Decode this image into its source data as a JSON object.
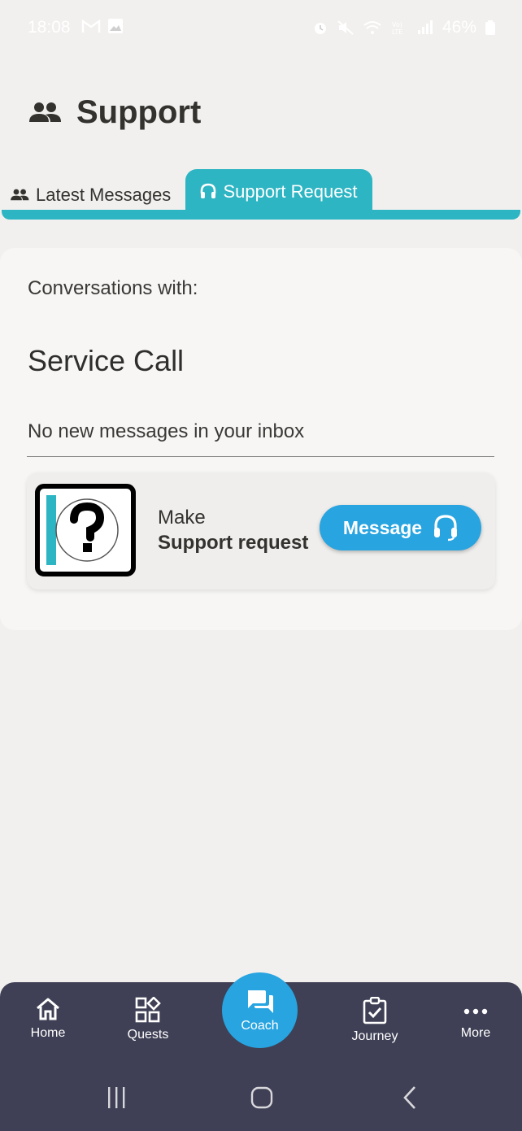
{
  "status_bar": {
    "time": "18:08",
    "battery": "46%",
    "left_icons": [
      "gmail-icon",
      "gallery-icon"
    ],
    "right_icons": [
      "alarm-icon",
      "mute-icon",
      "wifi-icon",
      "volte-icon",
      "signal-icon",
      "battery-icon"
    ]
  },
  "header": {
    "title": "Support",
    "icon": "people-icon"
  },
  "tabs": [
    {
      "label": "Latest Messages",
      "icon": "people-icon",
      "active": false
    },
    {
      "label": "Support Request",
      "icon": "headset-icon",
      "active": true
    }
  ],
  "content": {
    "conversations_label": "Conversations with:",
    "section_title": "Service Call",
    "empty_text": "No new messages in your inbox",
    "request_card": {
      "line1": "Make",
      "line2": "Support request",
      "button_label": "Message",
      "button_icon": "headset-icon",
      "logo_icon": "question-mark-icon"
    }
  },
  "bottom_nav": [
    {
      "label": "Home",
      "icon": "home-icon"
    },
    {
      "label": "Quests",
      "icon": "quests-icon"
    },
    {
      "label": "Coach",
      "icon": "chat-icon",
      "highlighted": true
    },
    {
      "label": "Journey",
      "icon": "checklist-icon"
    },
    {
      "label": "More",
      "icon": "more-icon"
    }
  ],
  "colors": {
    "accent_teal": "#2eb5c3",
    "button_blue": "#28a4e0",
    "nav_bg": "#3f4055",
    "page_bg": "#f1f0ee"
  }
}
